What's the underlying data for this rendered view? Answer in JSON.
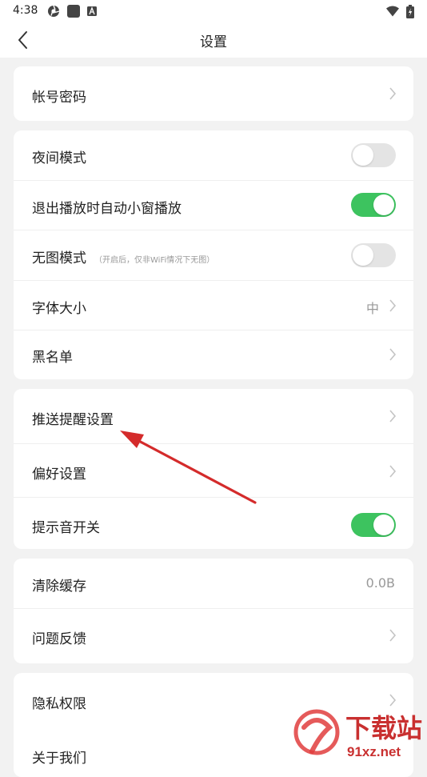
{
  "status_bar": {
    "time": "4:38"
  },
  "header": {
    "title": "设置"
  },
  "cards": [
    {
      "rows": [
        {
          "label": "帐号密码"
        }
      ]
    },
    {
      "rows": [
        {
          "label": "夜间模式",
          "toggle": "off"
        },
        {
          "label": "退出播放时自动小窗播放",
          "toggle": "on"
        },
        {
          "label": "无图模式",
          "note": "（开启后，仅非WiFi情况下无图）",
          "toggle": "off"
        },
        {
          "label": "字体大小",
          "value": "中"
        },
        {
          "label": "黑名单"
        }
      ]
    },
    {
      "rows": [
        {
          "label": "推送提醒设置"
        },
        {
          "label": "偏好设置"
        },
        {
          "label": "提示音开关",
          "toggle": "on"
        }
      ]
    },
    {
      "rows": [
        {
          "label": "清除缓存",
          "value": "0.0B"
        },
        {
          "label": "问题反馈"
        }
      ]
    },
    {
      "rows": [
        {
          "label": "隐私权限"
        },
        {
          "label": "关于我们"
        }
      ]
    }
  ],
  "colors": {
    "toggle_on": "#3dc35f",
    "toggle_off": "#e4e4e4",
    "annotation_arrow": "#d42b2b"
  },
  "watermark": {
    "text_cn": "下载站",
    "text_domain": "91xz.net"
  }
}
